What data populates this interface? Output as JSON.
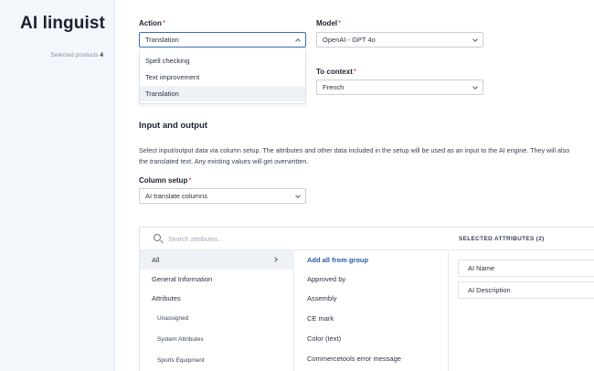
{
  "sidebar": {
    "title": "AI linguist",
    "selected_label": "Selected products",
    "selected_count": "4"
  },
  "form": {
    "action": {
      "label": "Action",
      "value": "Translation",
      "options": [
        "Spell checking",
        "Text improvement",
        "Translation"
      ]
    },
    "model": {
      "label": "Model",
      "value": "OpenAI - GPT 4o"
    },
    "to_context": {
      "label": "To context",
      "value": "French"
    },
    "required_mark": "*"
  },
  "io": {
    "title": "Input and output",
    "desc_line1": "Select input/output data via column setup. The attributes and other data included in the setup will be used as an input to the AI engine. They will also",
    "desc_line2": "the translated text. Any existing values will get overwritten.",
    "column_setup": {
      "label": "Column setup",
      "value": "AI translate columns"
    }
  },
  "attributes_panel": {
    "search_placeholder": "Search attributes...",
    "groups": [
      {
        "label": "All",
        "active": true
      },
      {
        "label": "General Information"
      },
      {
        "label": "Attributes"
      },
      {
        "label": "Unassigned",
        "sub": true
      },
      {
        "label": "System Attributes",
        "sub": true
      },
      {
        "label": "Sports Equipment",
        "sub": true
      }
    ],
    "add_all_label": "Add all from group",
    "attributes": [
      "Approved by",
      "Assembly",
      "CE mark",
      "Color (text)",
      "Commercetools error message"
    ],
    "selected_header": "SELECTED ATTRIBUTES (2)",
    "selected": [
      "AI Name",
      "AI Description"
    ]
  },
  "colors": {
    "accent": "#3b6fb6",
    "link": "#2b5aa8",
    "sidebar_bg": "#f3f6fb",
    "required": "#c0392b"
  }
}
